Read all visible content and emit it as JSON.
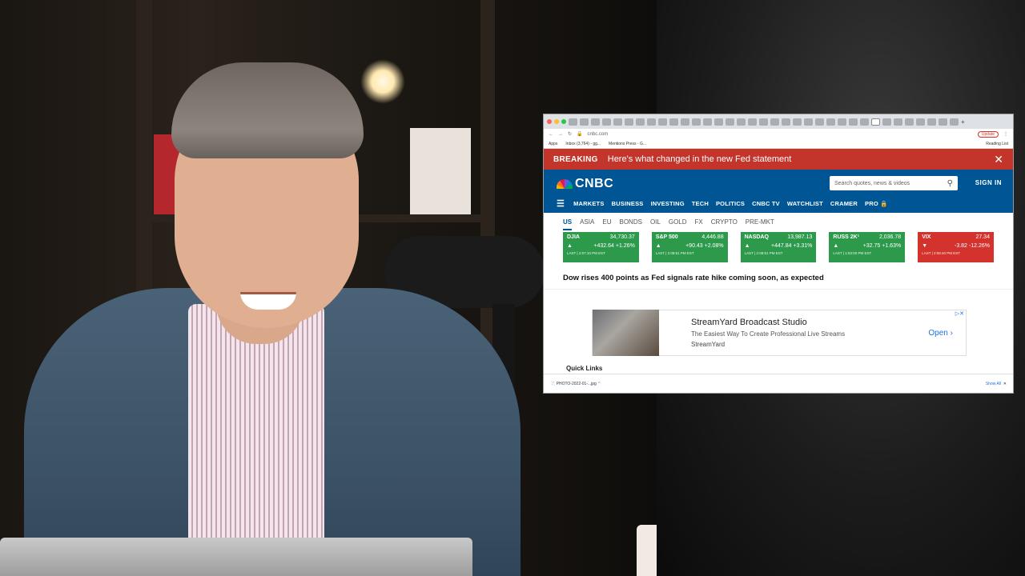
{
  "browser": {
    "url": "cnbc.com",
    "update_label": "Update",
    "bookmarks": [
      "Apps",
      "Inbox (3,764) - gg...",
      "Mentions Press - G..."
    ],
    "reading_list": "Reading List"
  },
  "breaking": {
    "tag": "BREAKING",
    "headline": "Here's what changed in the new Fed statement"
  },
  "header": {
    "logo": "CNBC",
    "search_placeholder": "Search quotes, news & videos",
    "sign_in": "SIGN IN",
    "nav": [
      "MARKETS",
      "BUSINESS",
      "INVESTING",
      "TECH",
      "POLITICS",
      "CNBC TV",
      "WATCHLIST",
      "CRAMER",
      "PRO 🔒"
    ]
  },
  "market_tabs": [
    "US",
    "ASIA",
    "EU",
    "BONDS",
    "OIL",
    "GOLD",
    "FX",
    "CRYPTO",
    "PRE-MKT"
  ],
  "quotes": [
    {
      "name": "DJIA",
      "price": "34,730.37",
      "change": "+432.64",
      "pct": "+1.26%",
      "last": "LAST | 2:07:10 PM EST",
      "dir": "up"
    },
    {
      "name": "S&P 500",
      "price": "4,446.88",
      "change": "+90.43",
      "pct": "+2.08%",
      "last": "LAST | 2:08:51 PM EST",
      "dir": "up"
    },
    {
      "name": "NASDAQ",
      "price": "13,987.13",
      "change": "+447.84",
      "pct": "+3.31%",
      "last": "LAST | 2:08:51 PM EST",
      "dir": "up"
    },
    {
      "name": "RUSS 2K¹",
      "price": "2,036.78",
      "change": "+32.75",
      "pct": "+1.63%",
      "last": "LAST | 1:53:00 PM EST",
      "dir": "up"
    },
    {
      "name": "VIX",
      "price": "27.34",
      "change": "-3.82",
      "pct": "-12.26%",
      "last": "LAST | 2:08:40 PM EST",
      "dir": "down"
    }
  ],
  "story": "Dow rises 400 points as Fed signals rate hike coming soon, as expected",
  "ad": {
    "title": "StreamYard Broadcast Studio",
    "subtitle": "The Easiest Way To Create Professional Live Streams",
    "brand": "StreamYard",
    "cta": "Open"
  },
  "quick_links": "Quick Links",
  "downloads": {
    "file": "PHOTO-2022-01-...jpg",
    "show_all": "Show All"
  }
}
